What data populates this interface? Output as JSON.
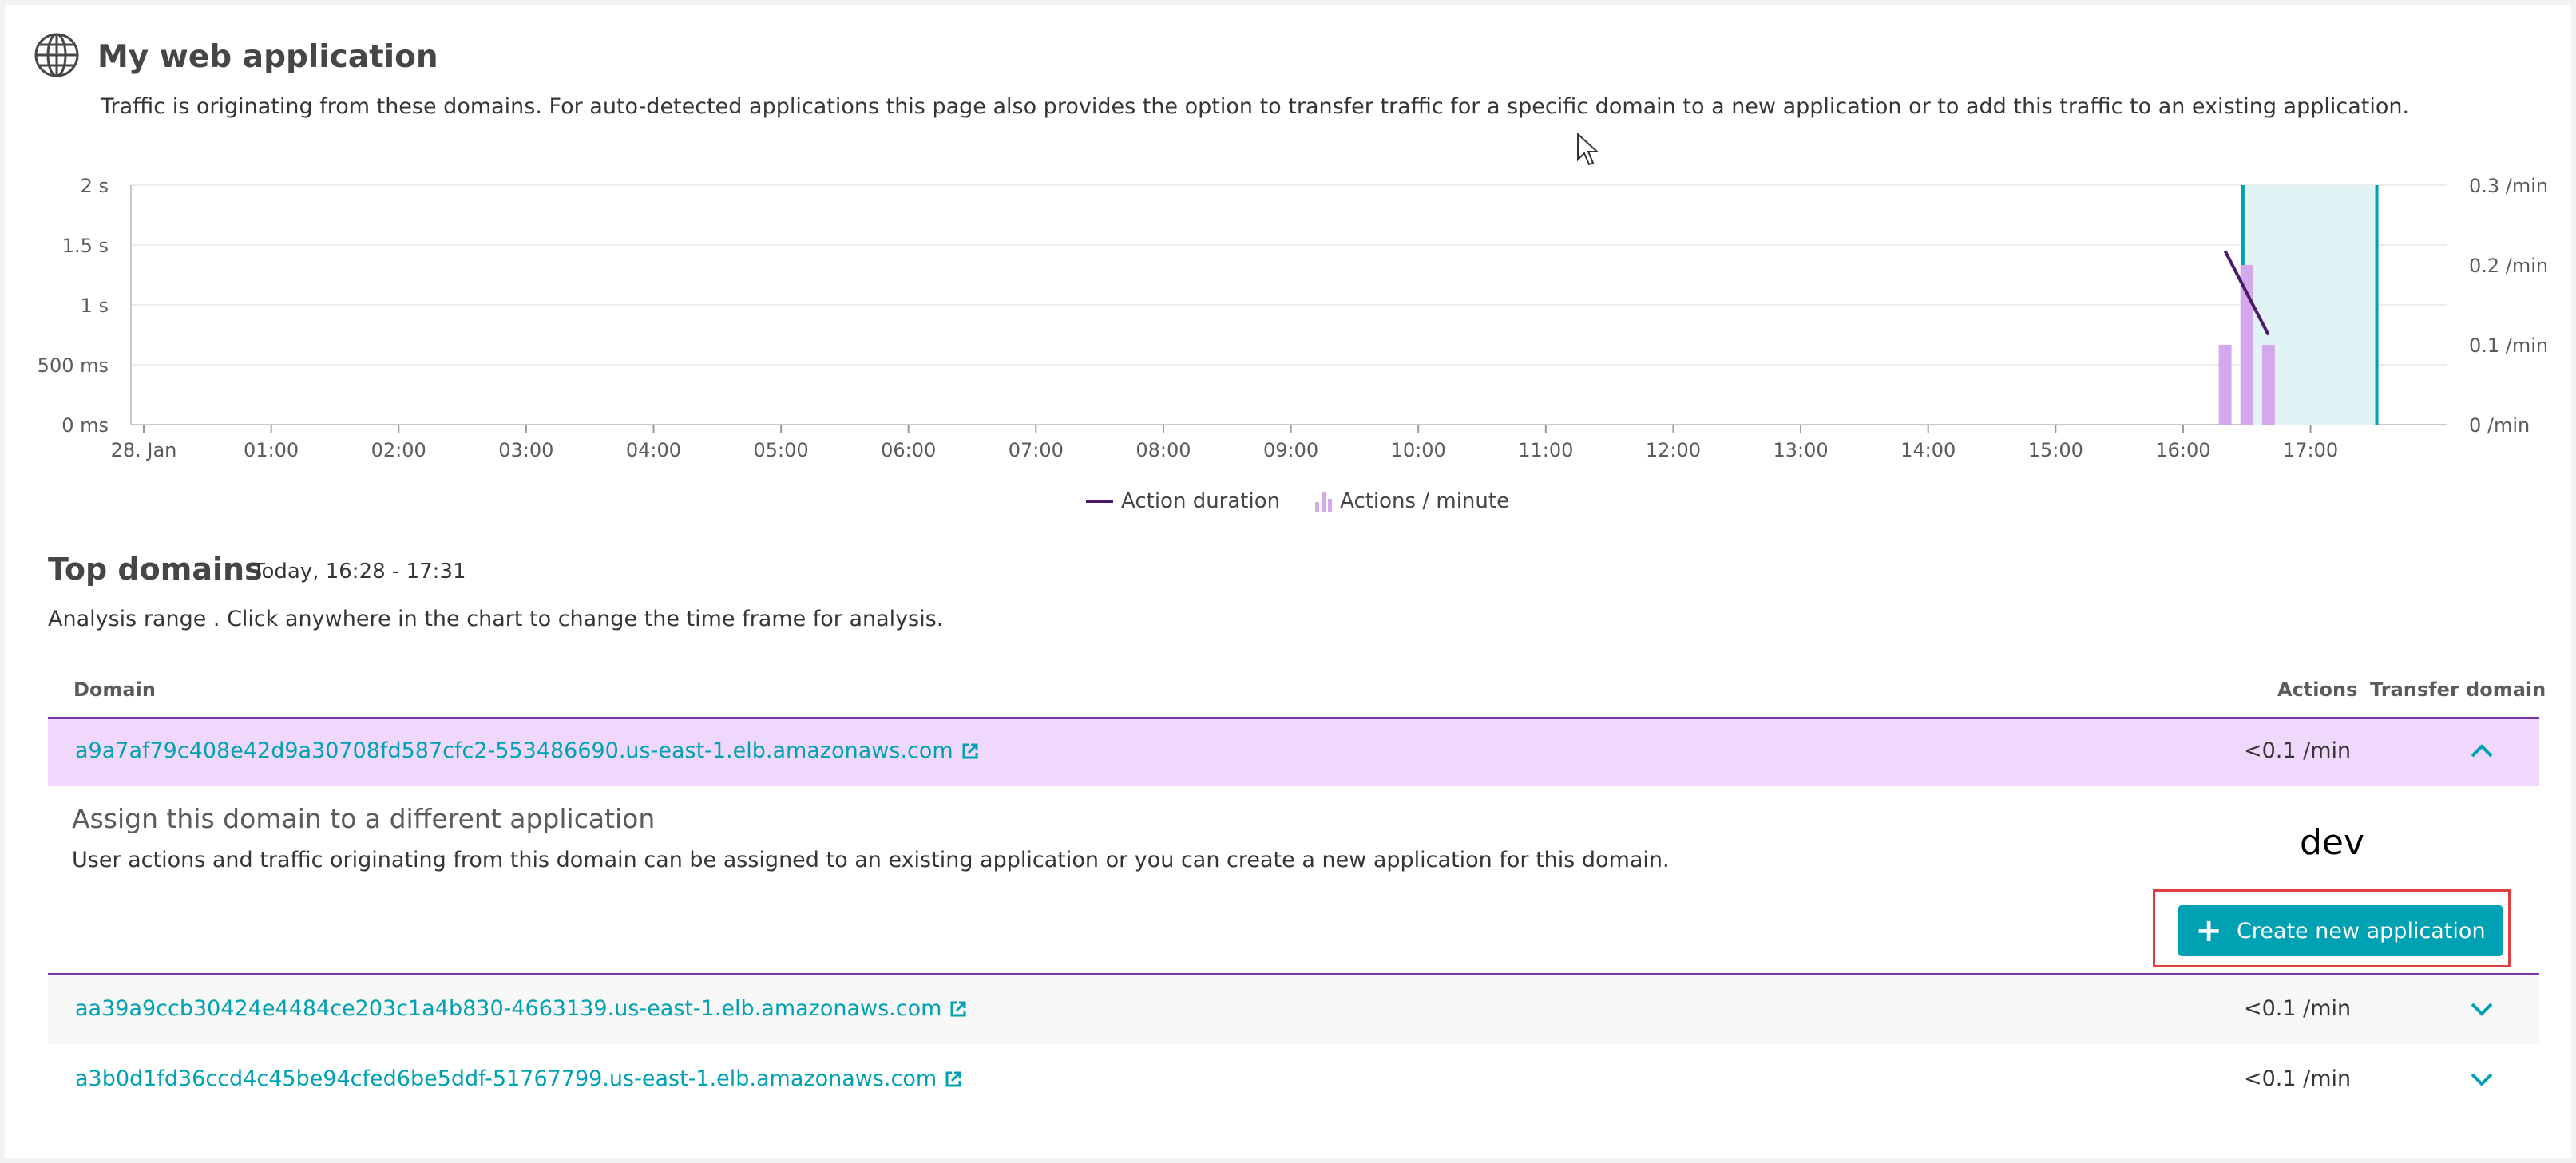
{
  "header": {
    "title": "My web application",
    "description": "Traffic is originating from these domains. For auto-detected applications this page also provides the option to transfer traffic for a specific domain to a new application or to add this traffic to an existing application."
  },
  "chart_data": {
    "type": "bar",
    "x_ticks": [
      "28. Jan",
      "01:00",
      "02:00",
      "03:00",
      "04:00",
      "05:00",
      "06:00",
      "07:00",
      "08:00",
      "09:00",
      "10:00",
      "11:00",
      "12:00",
      "13:00",
      "14:00",
      "15:00",
      "16:00",
      "17:00"
    ],
    "y_left_ticks": [
      "0 ms",
      "500 ms",
      "1 s",
      "1.5 s",
      "2 s"
    ],
    "y_right_ticks": [
      "0 /min",
      "0.1 /min",
      "0.2 /min",
      "0.3 /min"
    ],
    "ylim_left_seconds": [
      0,
      2
    ],
    "ylim_right_per_min": [
      0,
      0.3
    ],
    "x_range_hours": [
      0,
      17.667
    ],
    "series": [
      {
        "name": "Actions / minute",
        "kind": "bar",
        "color": "#d3a8ec",
        "points": [
          {
            "x_hour": 16.33,
            "y": 0.1
          },
          {
            "x_hour": 16.5,
            "y": 0.2
          },
          {
            "x_hour": 16.67,
            "y": 0.1
          }
        ]
      },
      {
        "name": "Action duration",
        "kind": "line",
        "color": "#4b1b6b",
        "points": [
          {
            "x_hour": 16.33,
            "y": 1.45
          },
          {
            "x_hour": 16.67,
            "y": 0.75
          }
        ]
      }
    ],
    "selection": {
      "from_hour": 16.47,
      "to_hour": 17.52,
      "color": "#00a1b2"
    },
    "grid": true,
    "legend_position": "bottom-center"
  },
  "legend": {
    "duration_label": "Action duration",
    "actions_label": "Actions / minute"
  },
  "top_domains": {
    "title": "Top domains",
    "range": "Today, 16:28 - 17:31",
    "analysis_text": "Analysis range . Click anywhere in the chart to change the time frame for analysis.",
    "columns": {
      "domain": "Domain",
      "actions": "Actions",
      "transfer": "Transfer domain"
    },
    "rows": [
      {
        "domain": "a9a7af79c408e42d9a30708fd587cfc2-553486690.us-east-1.elb.amazonaws.com",
        "actions": "<0.1 /min",
        "expanded": true
      },
      {
        "domain": "aa39a9ccb30424e4484ce203c1a4b830-4663139.us-east-1.elb.amazonaws.com",
        "actions": "<0.1 /min",
        "expanded": false
      },
      {
        "domain": "a3b0d1fd36ccd4c45be94cfed6be5ddf-51767799.us-east-1.elb.amazonaws.com",
        "actions": "<0.1 /min",
        "expanded": false
      }
    ],
    "assign": {
      "title": "Assign this domain to a different application",
      "description": "User actions and traffic originating from this domain can be assigned to an existing application or you can create a new application for this domain.",
      "annotation": "dev",
      "create_button": "Create new application"
    }
  },
  "colors": {
    "accent": "#00a1b2",
    "purple": "#7c38a1",
    "row_highlight": "#efd8fb",
    "bar": "#d3a8ec",
    "line": "#4b1b6b"
  }
}
